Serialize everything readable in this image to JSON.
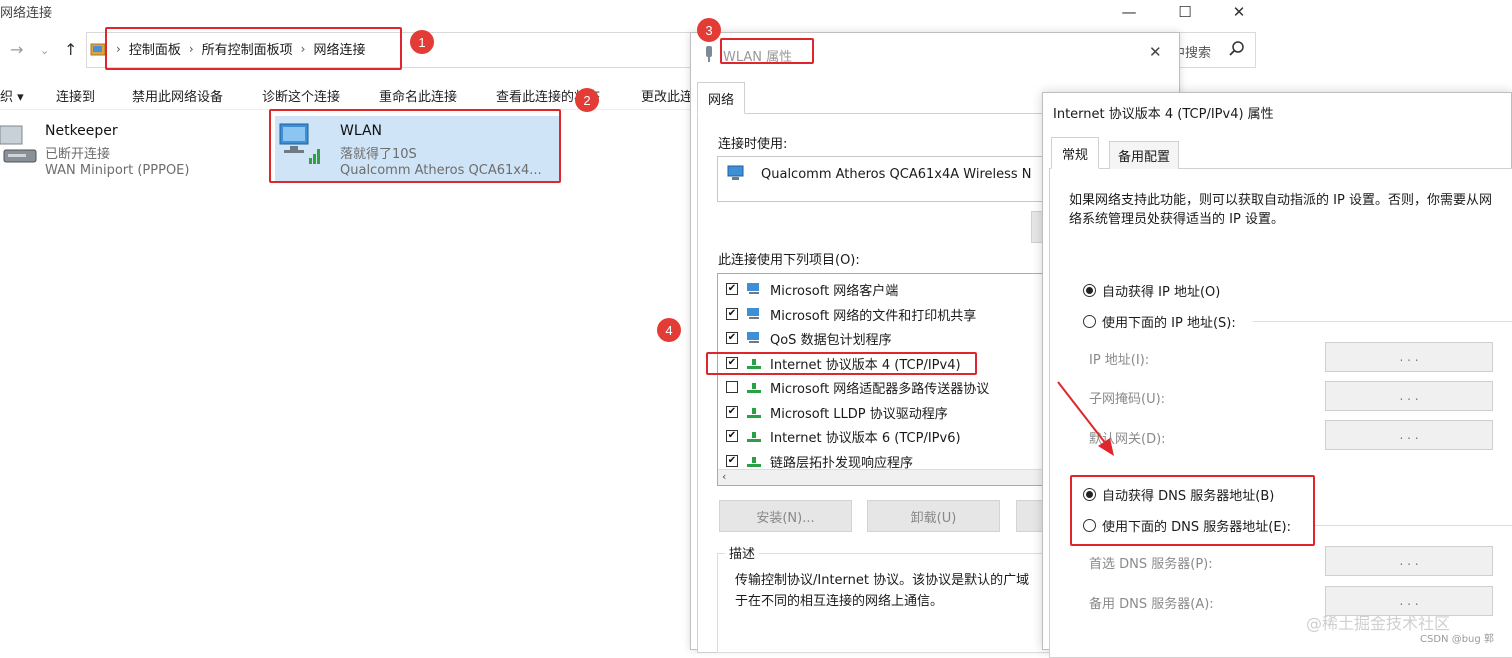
{
  "explorer": {
    "title": "网络连接",
    "breadcrumb": [
      "控制面板",
      "所有控制面板项",
      "网络连接"
    ],
    "search_placeholder": "中搜索",
    "cmdbar": [
      "织 ▾",
      "连接到",
      "禁用此网络设备",
      "诊断这个连接",
      "重命名此连接",
      "查看此连接的状态",
      "更改此连"
    ],
    "connections": [
      {
        "name": "Netkeeper",
        "status": "已断开连接",
        "adapter": "WAN Miniport (PPPOE)"
      },
      {
        "name": "WLAN",
        "status": "落就得了10S",
        "adapter": "Qualcomm Atheros QCA61x4..."
      }
    ]
  },
  "wlan_dialog": {
    "title": "WLAN 属性",
    "tab": "网络",
    "connect_using_label": "连接时使用:",
    "adapter": "Qualcomm Atheros QCA61x4A Wireless N",
    "items_label": "此连接使用下列项目(O):",
    "items": [
      {
        "label": "Microsoft 网络客户端",
        "checked": true,
        "icon": "network-client-icon"
      },
      {
        "label": "Microsoft 网络的文件和打印机共享",
        "checked": true,
        "icon": "file-share-icon"
      },
      {
        "label": "QoS 数据包计划程序",
        "checked": true,
        "icon": "qos-icon"
      },
      {
        "label": "Internet 协议版本 4 (TCP/IPv4)",
        "checked": true,
        "icon": "protocol-icon"
      },
      {
        "label": "Microsoft 网络适配器多路传送器协议",
        "checked": false,
        "icon": "protocol-icon"
      },
      {
        "label": "Microsoft LLDP 协议驱动程序",
        "checked": true,
        "icon": "protocol-icon"
      },
      {
        "label": "Internet 协议版本 6 (TCP/IPv6)",
        "checked": true,
        "icon": "protocol-icon"
      },
      {
        "label": "链路层拓扑发现响应程序",
        "checked": true,
        "icon": "protocol-icon"
      }
    ],
    "install_button": "安装(N)...",
    "uninstall_button": "卸载(U)",
    "description_label": "描述",
    "description_text_1": "传输控制协议/Internet 协议。该协议是默认的广域",
    "description_text_2": "于在不同的相互连接的网络上通信。"
  },
  "ipv4_dialog": {
    "title": "Internet 协议版本 4 (TCP/IPv4) 属性",
    "tabs": [
      "常规",
      "备用配置"
    ],
    "intro_1": "如果网络支持此功能，则可以获取自动指派的 IP 设置。否则，你需要从网",
    "intro_2": "络系统管理员处获得适当的 IP 设置。",
    "auto_ip": "自动获得 IP 地址(O)",
    "manual_ip": "使用下面的 IP 地址(S):",
    "ip_address": "IP 地址(I):",
    "subnet_mask": "子网掩码(U):",
    "gateway": "默认网关(D):",
    "auto_dns": "自动获得 DNS 服务器地址(B)",
    "manual_dns": "使用下面的 DNS 服务器地址(E):",
    "preferred_dns": "首选 DNS 服务器(P):",
    "alternate_dns": "备用 DNS 服务器(A):",
    "ip_dots": ". . ."
  },
  "annotations": {
    "badges": [
      "1",
      "2",
      "3",
      "4"
    ],
    "color": "#e0262d"
  },
  "watermark": {
    "main": "@稀土掘金技术社区",
    "sub": "CSDN @bug 郭"
  }
}
